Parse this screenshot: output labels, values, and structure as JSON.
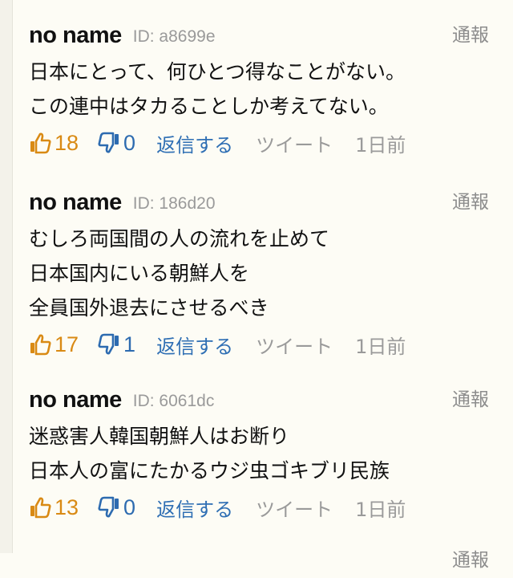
{
  "colors": {
    "background": "#fdfcf5",
    "upvote": "#d98a14",
    "downvote": "#2d6bb0",
    "reply_link": "#2f6fb4",
    "muted": "#9a9a9a"
  },
  "icons": {
    "upvote": "thumbs-up-icon",
    "downvote": "thumbs-down-icon"
  },
  "comments": [
    {
      "username": "no name",
      "id_label": "ID: a8699e",
      "report_label": "通報",
      "lines": [
        "日本にとって、何ひとつ得なことがない。",
        "この連中はタカることしか考えてない。"
      ],
      "upvotes": "18",
      "downvotes": "0",
      "reply_label": "返信する",
      "tweet_label": "ツイート",
      "time": "1日前"
    },
    {
      "username": "no name",
      "id_label": "ID: 186d20",
      "report_label": "通報",
      "lines": [
        "むしろ両国間の人の流れを止めて",
        "日本国内にいる朝鮮人を",
        "全員国外退去にさせるべき"
      ],
      "upvotes": "17",
      "downvotes": "1",
      "reply_label": "返信する",
      "tweet_label": "ツイート",
      "time": "1日前"
    },
    {
      "username": "no name",
      "id_label": "ID: 6061dc",
      "report_label": "通報",
      "lines": [
        "迷惑害人韓国朝鮮人はお断り",
        "日本人の富にたかるウジ虫ゴキブリ民族"
      ],
      "upvotes": "13",
      "downvotes": "0",
      "reply_label": "返信する",
      "tweet_label": "ツイート",
      "time": "1日前"
    },
    {
      "report_label": "通報"
    }
  ]
}
